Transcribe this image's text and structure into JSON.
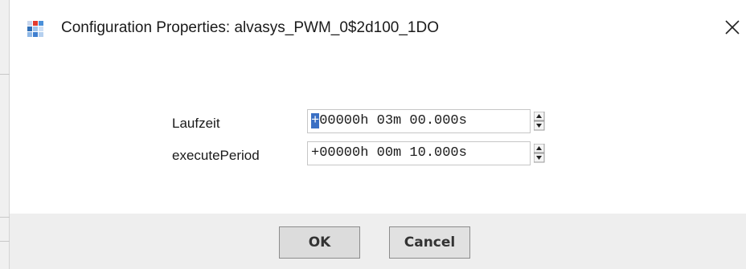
{
  "window": {
    "title": "Configuration Properties: alvasys_PWM_0$2d100_1DO",
    "close_icon": "close-icon",
    "app_icon": "niagara-app-icon"
  },
  "fields": [
    {
      "label": "Laufzeit",
      "value_prefix": "+",
      "value_rest": "00000h 03m 00.000s",
      "spinner_icon": "spinner-icon"
    },
    {
      "label": "executePeriod",
      "value": "+00000h 00m 10.000s",
      "spinner_icon": "spinner-icon"
    }
  ],
  "buttons": {
    "ok_label": "OK",
    "cancel_label": "Cancel"
  },
  "colors": {
    "selection": "#3a6fc4",
    "footer_bg": "#eeeeee"
  }
}
